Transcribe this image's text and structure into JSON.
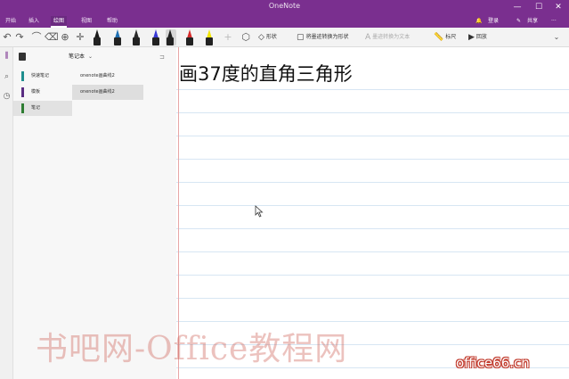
{
  "window": {
    "title": "OneNote"
  },
  "menu": {
    "tabs": [
      "开始",
      "插入",
      "绘图",
      "视图",
      "帮助"
    ],
    "active_index": 2,
    "share_label": "共享",
    "user_label": "登录"
  },
  "ribbon": {
    "lasso_label": "形状",
    "ink_to_shape_label": "将墨迹转换为形状",
    "ink_to_text_label": "墨迹转换为文本",
    "ruler_label": "标尺",
    "replay_label": "回放",
    "colors": {
      "pen1": "#1a1a1a",
      "pen2": "#1f6fb2",
      "pen3": "#2a2a2a",
      "pen4": "#3a3ad6",
      "pen5": "#d62b2b",
      "pen6": "#202020",
      "highlighter": "#f2e600"
    }
  },
  "nav": {
    "notebook_name": "笔记本",
    "sections": [
      {
        "label": "快速笔记",
        "color": "#1f8f8f"
      },
      {
        "label": "模板",
        "color": "#5a2d82"
      },
      {
        "label": "笔记",
        "color": "#2e7d32"
      }
    ],
    "pages": [
      {
        "label": "onenote画曲线2"
      },
      {
        "label": "onenote画曲线2"
      }
    ]
  },
  "page": {
    "title": "画37度的直角三角形"
  },
  "watermark": {
    "text": "书吧网-Office教程网",
    "logo": "office66.cn"
  },
  "theme": {
    "accent": "#7a2f8f"
  }
}
